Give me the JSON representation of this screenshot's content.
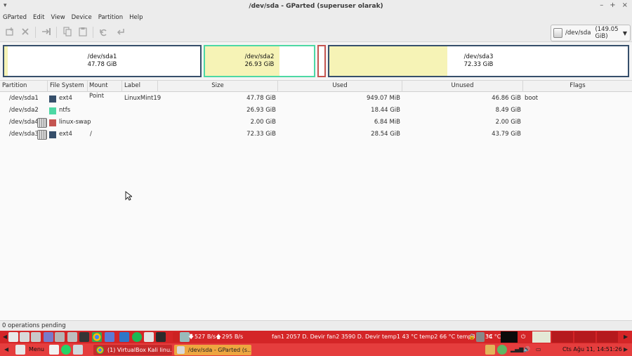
{
  "window": {
    "title": "/dev/sda - GParted (superuser olarak)",
    "menu_arrow": "▾",
    "buttons": {
      "minimize": "–",
      "maximize": "+",
      "close": "×"
    }
  },
  "menubar": [
    "GParted",
    "Edit",
    "View",
    "Device",
    "Partition",
    "Help"
  ],
  "toolbar": {
    "icons": [
      "new-partition-icon",
      "delete-icon",
      "resize-icon",
      "copy-icon",
      "paste-icon",
      "undo-icon",
      "apply-icon"
    ],
    "device_select": {
      "value": "/dev/sda",
      "size": "(149.05 GiB)"
    }
  },
  "visual_map": [
    {
      "name": "/dev/sda1",
      "size": "47.78 GiB",
      "border": "#364f6b"
    },
    {
      "name": "/dev/sda2",
      "size": "26.93 GiB",
      "border": "#4dd8a4"
    },
    {
      "name": "",
      "size": "",
      "border": "#c45450"
    },
    {
      "name": "/dev/sda3",
      "size": "72.33 GiB",
      "border": "#364f6b"
    }
  ],
  "table": {
    "headers": [
      "Partition",
      "File System",
      "Mount Point",
      "Label",
      "Size",
      "Used",
      "Unused",
      "Flags"
    ],
    "rows": [
      {
        "partition": "/dev/sda1",
        "fs": "ext4",
        "fs_color": "#364f6b",
        "mount": "",
        "label": "LinuxMint19",
        "size": "47.78 GiB",
        "used": "949.07 MiB",
        "unused": "46.86 GiB",
        "flags": "boot",
        "locked": false
      },
      {
        "partition": "/dev/sda2",
        "fs": "ntfs",
        "fs_color": "#4dd8a4",
        "mount": "",
        "label": "",
        "size": "26.93 GiB",
        "used": "18.44 GiB",
        "unused": "8.49 GiB",
        "flags": "",
        "locked": false
      },
      {
        "partition": "/dev/sda4",
        "fs": "linux-swap",
        "fs_color": "#c45450",
        "mount": "",
        "label": "",
        "size": "2.00 GiB",
        "used": "6.84 MiB",
        "unused": "2.00 GiB",
        "flags": "",
        "locked": true
      },
      {
        "partition": "/dev/sda3",
        "fs": "ext4",
        "fs_color": "#364f6b",
        "mount": "/",
        "label": "",
        "size": "72.33 GiB",
        "used": "28.54 GiB",
        "unused": "43.79 GiB",
        "flags": "",
        "locked": true
      }
    ]
  },
  "status": "0 operations pending",
  "panel_top": {
    "net_down": "527 B/s",
    "net_up": "295 B/s",
    "sensors": "fan1 2057 D. Devir fan2 3590 D. Devir temp1 43 °C temp2 66 °C temp3 50 °C",
    "temp": "34 °C"
  },
  "panel_bottom": {
    "menu_label": "Menu",
    "tasks": [
      "(1) VirtualBox Kali linu...",
      "/dev/sda - GParted (s..."
    ],
    "clock": "Cts Ağu 11, 14:51:26"
  }
}
